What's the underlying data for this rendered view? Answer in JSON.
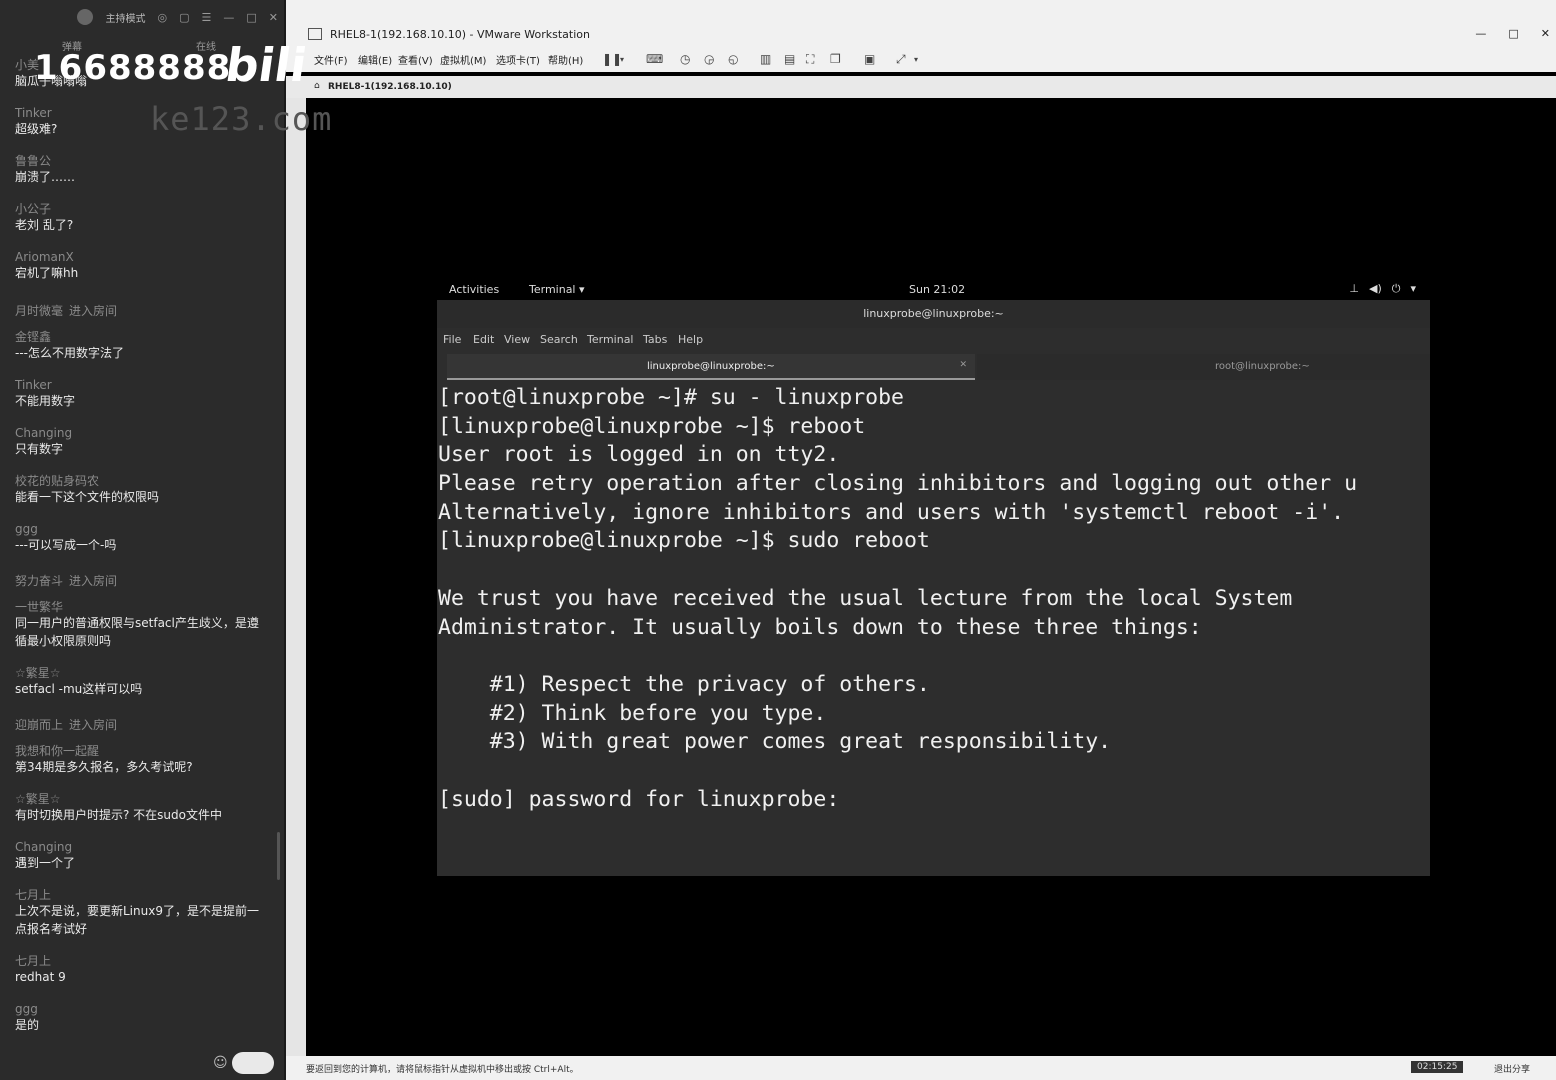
{
  "chat": {
    "topbar": {
      "mode_label": "主持模式"
    },
    "tabs": [
      "弹幕",
      "在线"
    ],
    "overlay": {
      "number": "16688888",
      "brand": "bili",
      "url": "ke123.com"
    },
    "messages": [
      {
        "name": "小美",
        "text": "脑瓜子嗡嗡嗡"
      },
      {
        "name": "Tinker",
        "text": "超级难?"
      },
      {
        "name": "鲁鲁公",
        "text": "崩溃了……"
      },
      {
        "name": "小公子",
        "text": "老刘 乱了?"
      },
      {
        "name": "AriomanX",
        "text": "宕机了嘛hh"
      },
      {
        "name": "月时微毫",
        "text": "进入房间",
        "enter": true
      },
      {
        "name": "金铿鑫",
        "text": "---怎么不用数字法了"
      },
      {
        "name": "Tinker",
        "text": "不能用数字"
      },
      {
        "name": "Changing",
        "text": "只有数字"
      },
      {
        "name": "校花的贴身码农",
        "text": "能看一下这个文件的权限吗"
      },
      {
        "name": "ggg",
        "text": "---可以写成一个-吗"
      },
      {
        "name": "努力奋斗",
        "text": "进入房间",
        "enter": true
      },
      {
        "name": "一世繁华",
        "text": "同一用户的普通权限与setfacl产生歧义，是遵循最小权限原则吗"
      },
      {
        "name": "☆繁星☆",
        "text": "setfacl  -mu这样可以吗"
      },
      {
        "name": "迎崩而上",
        "text": "进入房间",
        "enter": true
      },
      {
        "name": "我想和你一起醒",
        "text": "第34期是多久报名，多久考试呢?"
      },
      {
        "name": "☆繁星☆",
        "text": "有时切换用户时提示? 不在sudo文件中"
      },
      {
        "name": "Changing",
        "text": "遇到一个了"
      },
      {
        "name": "七月上",
        "text": "上次不是说，要更新Linux9了，是不是提前一点报名考试好"
      },
      {
        "name": "七月上",
        "text": "redhat 9"
      },
      {
        "name": "ggg",
        "text": "是的"
      }
    ]
  },
  "vmware": {
    "title": "RHEL8-1(192.168.10.10) - VMware Workstation",
    "window_controls": [
      "—",
      "□",
      "✕"
    ],
    "menus": [
      "文件(F)",
      "编辑(E)",
      "查看(V)",
      "虚拟机(M)",
      "选项卡(T)",
      "帮助(H)"
    ],
    "tab_label": "RHEL8-1(192.168.10.10)",
    "status_message": "要返回到您的计算机，请将鼠标指针从虚拟机中移出或按 Ctrl+Alt。",
    "status_clock": "02:15:25",
    "status_share": "退出分享"
  },
  "gnome": {
    "activities": "Activities",
    "app_menu": "Terminal ▾",
    "clock": "Sun 21:02",
    "sys_icons": [
      "network-icon",
      "volume-icon",
      "power-icon"
    ]
  },
  "terminal": {
    "window_title": "linuxprobe@linuxprobe:~",
    "menu": [
      "File",
      "Edit",
      "View",
      "Search",
      "Terminal",
      "Tabs",
      "Help"
    ],
    "tabs": [
      "linuxprobe@linuxprobe:~",
      "root@linuxprobe:~"
    ],
    "lines": [
      "[root@linuxprobe ~]# su - linuxprobe",
      "[linuxprobe@linuxprobe ~]$ reboot",
      "User root is logged in on tty2.",
      "Please retry operation after closing inhibitors and logging out other u",
      "Alternatively, ignore inhibitors and users with 'systemctl reboot -i'.",
      "[linuxprobe@linuxprobe ~]$ sudo reboot",
      "",
      "We trust you have received the usual lecture from the local System",
      "Administrator. It usually boils down to these three things:",
      "",
      "    #1) Respect the privacy of others.",
      "    #2) Think before you type.",
      "    #3) With great power comes great responsibility.",
      "",
      "[sudo] password for linuxprobe:"
    ]
  }
}
